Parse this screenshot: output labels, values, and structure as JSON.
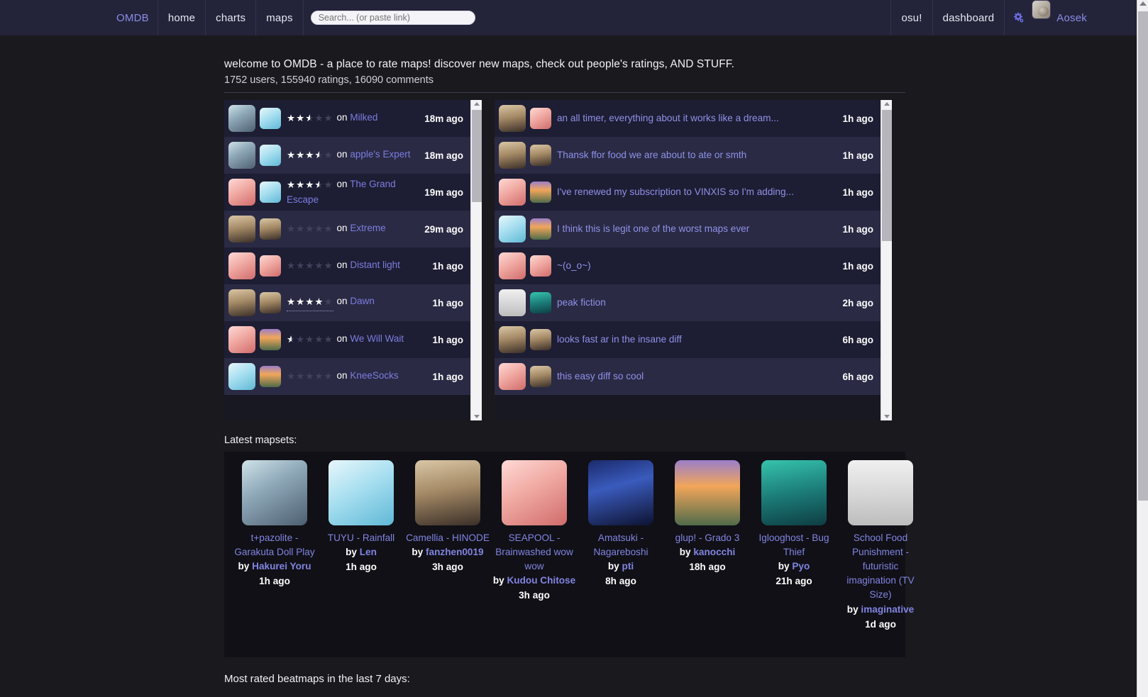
{
  "nav": {
    "brand": "OMDB",
    "left_items": [
      {
        "label": "home",
        "name": "nav-home"
      },
      {
        "label": "charts",
        "name": "nav-charts"
      },
      {
        "label": "maps",
        "name": "nav-maps"
      }
    ],
    "search_placeholder": "Search... (or paste link)",
    "search_value": "",
    "right_items": [
      {
        "label": "osu!",
        "name": "nav-osu"
      },
      {
        "label": "dashboard",
        "name": "nav-dashboard"
      }
    ],
    "settings_icon": "gear-icon",
    "username": "Aosek"
  },
  "welcome": {
    "title": "welcome to OMDB - a place to rate maps! discover new maps, check out people's ratings, AND STUFF.",
    "stats": "1752 users, 155940 ratings, 16090 comments"
  },
  "ratings_feed": [
    {
      "stars": "2.5",
      "prefix": "on ",
      "map": "Milked",
      "time": "18m ago",
      "cover": "c0",
      "avatar": "c1",
      "underline": false
    },
    {
      "stars": "3.5",
      "prefix": "on ",
      "map": "apple's Expert",
      "time": "18m ago",
      "cover": "c0",
      "avatar": "c1",
      "underline": false
    },
    {
      "stars": "3.5",
      "prefix": "on ",
      "map": "The Grand Escape",
      "time": "19m ago",
      "cover": "c3",
      "avatar": "c1",
      "underline": false
    },
    {
      "stars": "0",
      "prefix": "on ",
      "map": "Extreme",
      "time": "29m ago",
      "cover": "c2",
      "avatar": "c2",
      "underline": false
    },
    {
      "stars": "0",
      "prefix": "on ",
      "map": "Distant light",
      "time": "1h ago",
      "cover": "c3",
      "avatar": "c3",
      "underline": false
    },
    {
      "stars": "4",
      "prefix": "on ",
      "map": "Dawn",
      "time": "1h ago",
      "cover": "c2",
      "avatar": "c2",
      "underline": true
    },
    {
      "stars": "0.5",
      "prefix": "on ",
      "map": "We Will Wait",
      "time": "1h ago",
      "cover": "c3",
      "avatar": "c5",
      "underline": false
    },
    {
      "stars": "0",
      "prefix": "on ",
      "map": "KneeSocks",
      "time": "1h ago",
      "cover": "c1",
      "avatar": "c5",
      "underline": false
    }
  ],
  "comments_feed": [
    {
      "text": "an all timer, everything about it works like a dream...",
      "time": "1h ago",
      "cover": "c2",
      "avatar": "c3"
    },
    {
      "text": "Thansk ffor food we are about to ate or smth",
      "time": "1h ago",
      "cover": "c2",
      "avatar": "c2"
    },
    {
      "text": "I've renewed my subscription to VINXIS so I'm adding...",
      "time": "1h ago",
      "cover": "c3",
      "avatar": "c5"
    },
    {
      "text": "I think this is legit one of the worst maps ever",
      "time": "1h ago",
      "cover": "c1",
      "avatar": "c5"
    },
    {
      "text": "~(o_o~)",
      "time": "1h ago",
      "cover": "c3",
      "avatar": "c3"
    },
    {
      "text": "peak fiction",
      "time": "2h ago",
      "cover": "c7",
      "avatar": "c6"
    },
    {
      "text": "looks fast ar in the insane diff",
      "time": "6h ago",
      "cover": "c2",
      "avatar": "c2"
    },
    {
      "text": "this easy diff so cool",
      "time": "6h ago",
      "cover": "c3",
      "avatar": "c2"
    }
  ],
  "mapsets": {
    "heading": "Latest mapsets:",
    "by_label": "by",
    "items": [
      {
        "title": "t+pazolite - Garakuta Doll Play",
        "mapper": "Hakurei Yoru",
        "time": "1h ago",
        "cover": "c0"
      },
      {
        "title": "TUYU - Rainfall",
        "mapper": "Len",
        "time": "1h ago",
        "cover": "c1"
      },
      {
        "title": "Camellia - HINODE",
        "mapper": "fanzhen0019",
        "time": "3h ago",
        "cover": "c2"
      },
      {
        "title": "SEAPOOL - Brainwashed wow wow",
        "mapper": "Kudou Chitose",
        "time": "3h ago",
        "cover": "c3"
      },
      {
        "title": "Amatsuki - Nagareboshi",
        "mapper": "pti",
        "time": "8h ago",
        "cover": "c4"
      },
      {
        "title": "glup! - Grado 3",
        "mapper": "kanocchi",
        "time": "18h ago",
        "cover": "c5"
      },
      {
        "title": "Iglooghost - Bug Thief",
        "mapper": "Pyo",
        "time": "21h ago",
        "cover": "c6"
      },
      {
        "title": "School Food Punishment - futuristic imagination (TV Size)",
        "mapper": "imaginative",
        "time": "1d ago",
        "cover": "c7"
      }
    ]
  },
  "footer": {
    "most_rated_heading": "Most rated beatmaps in the last 7 days:"
  },
  "colors": {
    "navbar_bg": "#23233a",
    "page_bg": "#1a1a1e",
    "link": "#8284e2",
    "accent": "#7b7de0",
    "row_alt": "#2a2a44",
    "row_norm": "#1d1d33"
  }
}
